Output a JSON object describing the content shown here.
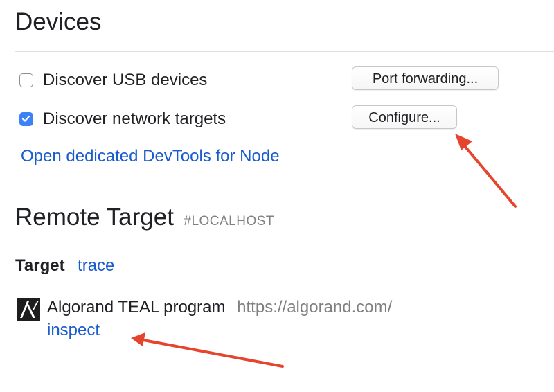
{
  "devices": {
    "title": "Devices",
    "discover_usb": {
      "label": "Discover USB devices",
      "checked": false
    },
    "discover_network": {
      "label": "Discover network targets",
      "checked": true
    },
    "port_forwarding_button": "Port forwarding...",
    "configure_button": "Configure...",
    "node_devtools_link": "Open dedicated DevTools for Node"
  },
  "remote_target": {
    "title": "Remote Target",
    "host": "#LOCALHOST",
    "target_heading": "Target",
    "trace_link": "trace",
    "items": [
      {
        "icon": "algorand-logo-icon",
        "name": "Algorand TEAL program",
        "url": "https://algorand.com/",
        "inspect_link": "inspect"
      }
    ]
  },
  "annotations": {
    "arrow_color": "#e5452c"
  }
}
